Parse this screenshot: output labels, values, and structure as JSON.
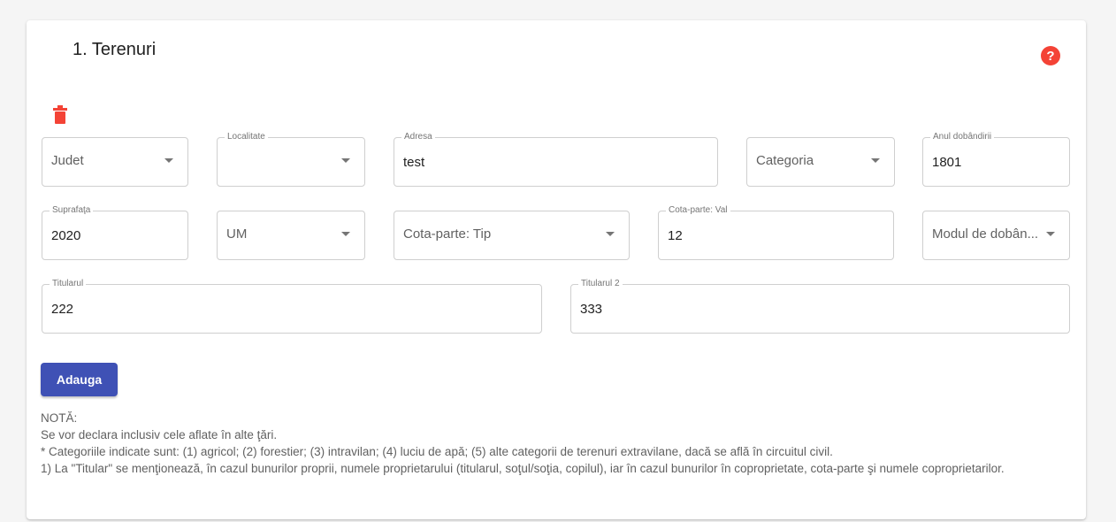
{
  "section": {
    "title": "1. Terenuri",
    "help_icon": "question-circle-icon",
    "delete_icon": "trash-icon",
    "accent_color": "#3f51b5",
    "danger_color": "#f44336"
  },
  "fields": {
    "judet": {
      "placeholder": "Judet",
      "value": ""
    },
    "localitate": {
      "label": "Localitate",
      "value": ""
    },
    "adresa": {
      "label": "Adresa",
      "value": "test"
    },
    "categoria": {
      "placeholder": "Categoria",
      "value": ""
    },
    "anul": {
      "label": "Anul dobândirii",
      "value": "1801"
    },
    "suprafata": {
      "label": "Suprafaţa",
      "value": "2020"
    },
    "um": {
      "placeholder": "UM",
      "value": ""
    },
    "cota_tip": {
      "placeholder": "Cota-parte: Tip",
      "value": ""
    },
    "cota_val": {
      "label": "Cota-parte: Val",
      "value": "12"
    },
    "modul": {
      "placeholder": "Modul de dobân...",
      "value": ""
    },
    "titularul": {
      "label": "Titularul",
      "value": "222"
    },
    "titularul2": {
      "label": "Titularul 2",
      "value": "333"
    }
  },
  "actions": {
    "add_label": "Adauga"
  },
  "note": {
    "heading": "NOTĂ:",
    "lines": [
      "Se vor declara inclusiv cele aflate în alte ţări.",
      "* Categoriile indicate sunt: (1) agricol; (2) forestier; (3) intravilan; (4) luciu de apă; (5) alte categorii de terenuri extravilane, dacă se află în circuitul civil.",
      "1) La \"Titular\" se menţionează, în cazul bunurilor proprii, numele proprietarului (titularul, soţul/soţia, copilul), iar în cazul bunurilor în coproprietate, cota-parte şi numele coproprietarilor."
    ]
  }
}
